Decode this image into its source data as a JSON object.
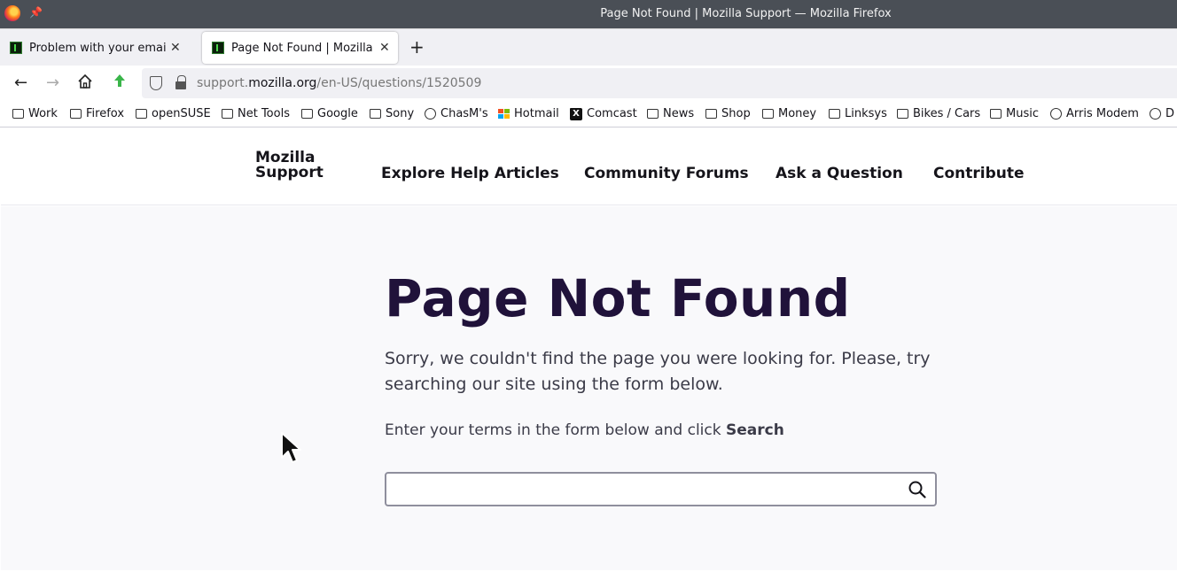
{
  "window": {
    "title": "Page Not Found | Mozilla Support — Mozilla Firefox"
  },
  "tabs": [
    {
      "label": "Problem with your email |",
      "active": false
    },
    {
      "label": "Page Not Found | Mozilla S",
      "active": true
    }
  ],
  "urlbar": {
    "url_prefix": "support.",
    "url_domain": "mozilla.org",
    "url_path": "/en-US/questions/1520509"
  },
  "bookmarks": [
    {
      "label": "Work",
      "icon": "folder"
    },
    {
      "label": "Firefox",
      "icon": "folder"
    },
    {
      "label": "openSUSE",
      "icon": "folder"
    },
    {
      "label": "Net Tools",
      "icon": "folder"
    },
    {
      "label": "Google",
      "icon": "folder"
    },
    {
      "label": "Sony",
      "icon": "folder"
    },
    {
      "label": "ChasM's",
      "icon": "globe"
    },
    {
      "label": "Hotmail",
      "icon": "microsoft"
    },
    {
      "label": "Comcast",
      "icon": "x-logo"
    },
    {
      "label": "News",
      "icon": "folder"
    },
    {
      "label": "Shop",
      "icon": "folder"
    },
    {
      "label": "Money",
      "icon": "folder"
    },
    {
      "label": "Linksys",
      "icon": "folder"
    },
    {
      "label": "Bikes / Cars",
      "icon": "folder"
    },
    {
      "label": "Music",
      "icon": "folder"
    },
    {
      "label": "Arris Modem",
      "icon": "globe"
    },
    {
      "label": "D",
      "icon": "globe"
    }
  ],
  "site": {
    "logo_line1": "Mozilla",
    "logo_line2": "Support",
    "nav": {
      "explore": "Explore Help Articles",
      "forums": "Community Forums",
      "ask": "Ask a Question",
      "contribute": "Contribute"
    }
  },
  "main": {
    "heading": "Page Not Found",
    "lead": "Sorry, we couldn't find the page you were looking for. Please, try searching our site using the form below.",
    "hint_text": "Enter your terms in the form below and click ",
    "hint_bold": "Search",
    "search_value": ""
  },
  "colors": {
    "heading": "#20123a",
    "titlebar": "#4a4f56",
    "content_bg": "#f9f9fb"
  }
}
